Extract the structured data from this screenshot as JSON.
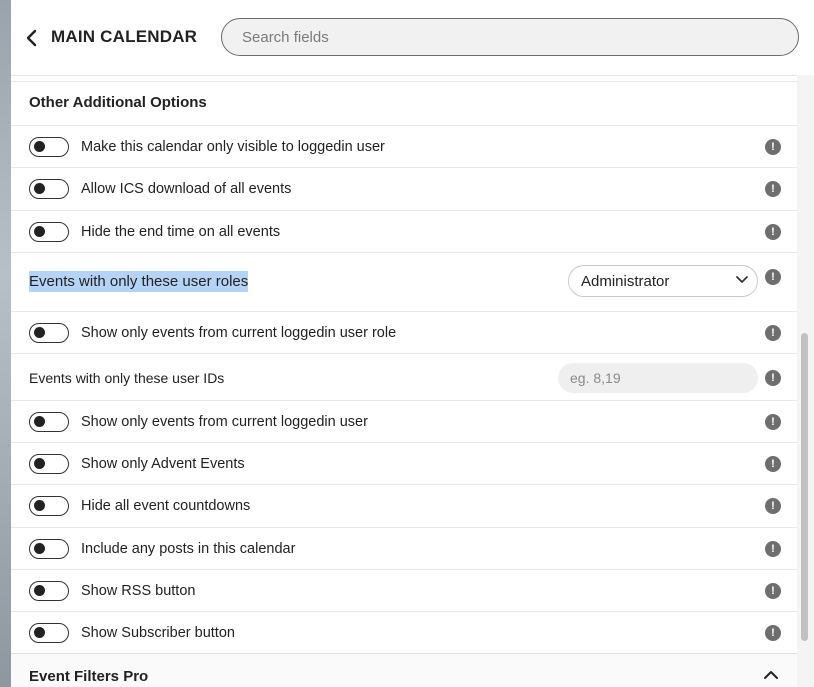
{
  "header": {
    "back_icon": "chevron-left-icon",
    "title": "MAIN CALENDAR",
    "search_placeholder": "Search fields"
  },
  "section": {
    "title": "Other Additional Options",
    "info_glyph": "!",
    "toggles_top": [
      {
        "label": "Make this calendar only visible to loggedin user",
        "on": false
      },
      {
        "label": "Allow ICS download of all events",
        "on": false
      },
      {
        "label": "Hide the end time on all events",
        "on": false
      }
    ],
    "roles_row": {
      "label": "Events with only these user roles",
      "selected": "Administrator"
    },
    "role_toggle": {
      "label": "Show only events from current loggedin user role",
      "on": false
    },
    "ids_row": {
      "label": "Events with only these user IDs",
      "placeholder": "eg. 8,19"
    },
    "toggles_bottom": [
      {
        "label": "Show only events from current loggedin user",
        "on": false
      },
      {
        "label": "Show only Advent Events",
        "on": false
      },
      {
        "label": "Hide all event countdowns",
        "on": false
      },
      {
        "label": "Include any posts in this calendar",
        "on": false
      },
      {
        "label": "Show RSS button",
        "on": false
      },
      {
        "label": "Show Subscriber button",
        "on": false
      }
    ]
  },
  "footer": {
    "title": "Event Filters Pro",
    "chevron_icon": "chevron-up-icon"
  },
  "colors": {
    "highlight": "#b5d3f5",
    "info_badge": "#6e6e6e"
  }
}
